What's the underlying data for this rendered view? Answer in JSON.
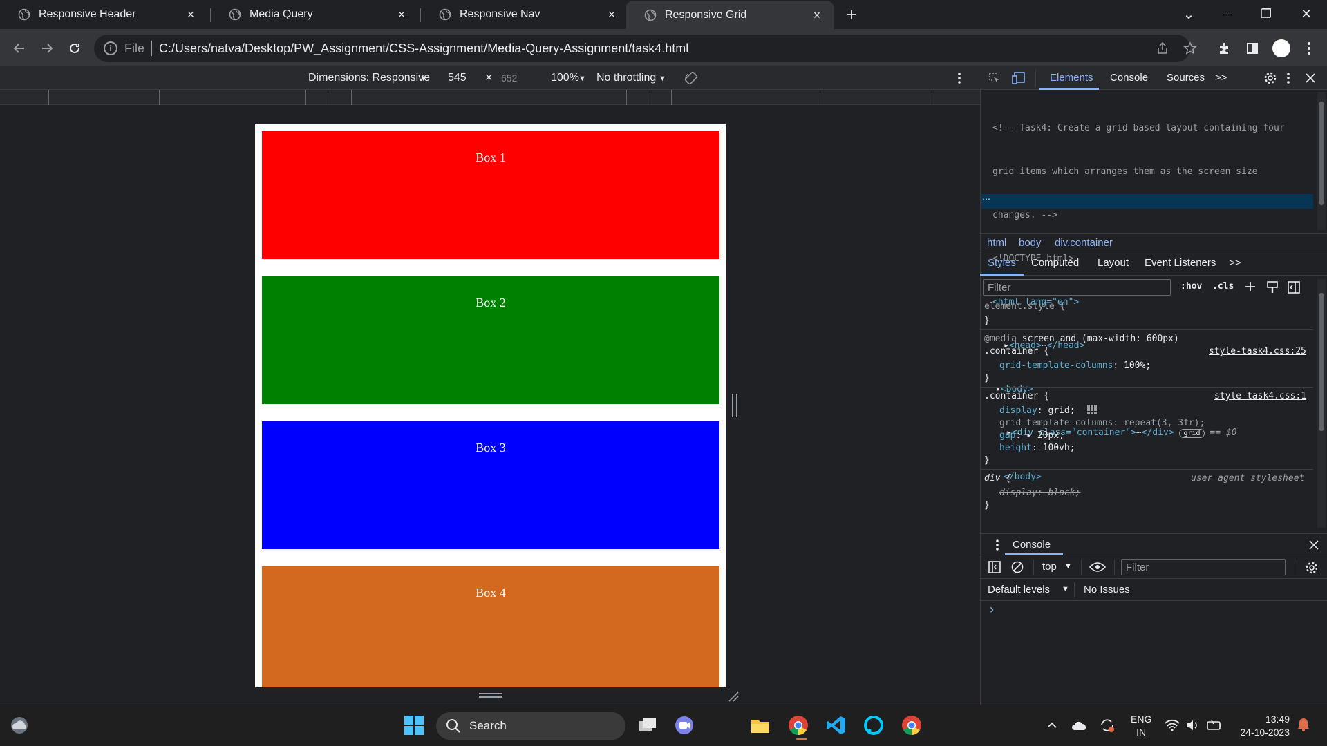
{
  "tabs": [
    {
      "label": "Responsive Header",
      "close": "×"
    },
    {
      "label": "Media Query",
      "close": "×"
    },
    {
      "label": "Responsive Nav",
      "close": "×"
    },
    {
      "label": "Responsive Grid",
      "close": "×",
      "active": true
    }
  ],
  "new_tab": "+",
  "window_controls": {
    "dropdown": "⌄",
    "minimize": "—",
    "restore": "❐",
    "close": "✕"
  },
  "omnibox": {
    "scheme_label": "File",
    "url": "C:/Users/natva/Desktop/PW_Assignment/CSS-Assignment/Media-Query-Assignment/task4.html"
  },
  "device_toolbar": {
    "dimensions": "Dimensions: Responsive",
    "width": "545",
    "times": "×",
    "height": "652",
    "zoom": "100%",
    "throttling": "No throttling"
  },
  "page": {
    "boxes": [
      {
        "label": "Box 1",
        "color": "#ff0000"
      },
      {
        "label": "Box 2",
        "color": "#008000"
      },
      {
        "label": "Box 3",
        "color": "#0000ff"
      },
      {
        "label": "Box 4",
        "color": "#d2691e"
      }
    ]
  },
  "devtools": {
    "tabs": [
      "Elements",
      "Console",
      "Sources"
    ],
    "more": ">>",
    "elements_lines": {
      "comment1": "<!-- Task4: Create a grid based layout containing four",
      "comment2": "grid items which arranges them as the screen size",
      "comment3": "changes. -->",
      "doctype": "<!DOCTYPE html>",
      "html_open": "<html lang=\"en\">",
      "head": "<head>",
      "head_close": "</head>",
      "body_open": "<body>",
      "div_open": "<div class=\"container\">",
      "div_close": "</div>",
      "grid_badge": "grid",
      "eq": "== $0",
      "body_close": "</body>",
      "ellipsis": "⋯"
    },
    "breadcrumbs": [
      "html",
      "body",
      "div.container"
    ],
    "style_tabs": [
      "Styles",
      "Computed",
      "Layout",
      "Event Listeners"
    ],
    "filter_placeholder": "Filter",
    "hov": ":hov",
    "cls": ".cls",
    "styles": {
      "element_style": "element.style {",
      "close_brace": "}",
      "media_at": "@media",
      "media_query": "screen and (max-width: 600px)",
      "container_sel": ".container {",
      "source1": "style-task4.css:25",
      "gtc_prop": "grid-template-columns",
      "gtc_val": "100%;",
      "source2": "style-task4.css:1",
      "display_prop": "display",
      "display_val": "grid;",
      "gtc_struck": "grid-template-columns: repeat(3, 3fr);",
      "gap_prop": "gap",
      "gap_val": "20px;",
      "height_prop": "height",
      "height_val": "100vh;",
      "div_sel": "div {",
      "ua": "user agent stylesheet",
      "div_display_struck": "display: block;"
    },
    "console": {
      "title": "Console",
      "context": "top",
      "filter_placeholder": "Filter",
      "levels": "Default levels",
      "issues": "No Issues",
      "prompt": "›"
    }
  },
  "taskbar": {
    "search": "Search",
    "lang1": "ENG",
    "lang2": "IN",
    "time": "13:49",
    "date": "24-10-2023"
  }
}
